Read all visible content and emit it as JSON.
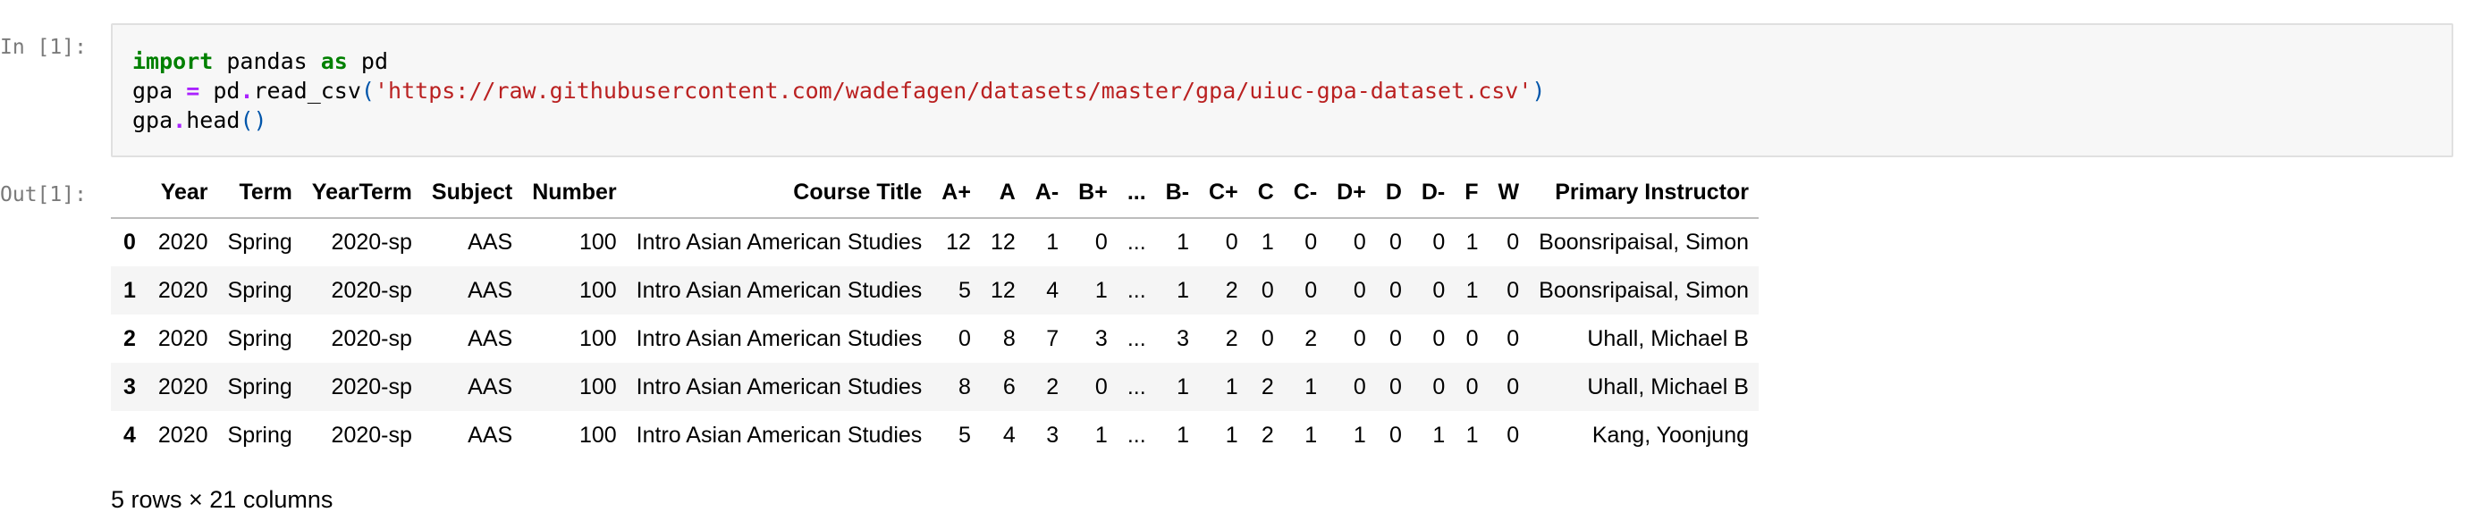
{
  "input_cell": {
    "prompt": "In [1]:",
    "code": {
      "line1": {
        "kw_import": "import",
        "module": " pandas ",
        "kw_as": "as",
        "alias": " pd"
      },
      "line2": {
        "var": "gpa ",
        "eq": "=",
        "call": " pd",
        "dot": ".",
        "func": "read_csv",
        "open": "(",
        "url": "'https://raw.githubusercontent.com/wadefagen/datasets/master/gpa/uiuc-gpa-dataset.csv'",
        "close": ")"
      },
      "line3": {
        "var": "gpa",
        "dot": ".",
        "func": "head",
        "parens": "()"
      }
    }
  },
  "output_cell": {
    "prompt": "Out[1]:",
    "table": {
      "columns": [
        "",
        "Year",
        "Term",
        "YearTerm",
        "Subject",
        "Number",
        "Course Title",
        "A+",
        "A",
        "A-",
        "B+",
        "...",
        "B-",
        "C+",
        "C",
        "C-",
        "D+",
        "D",
        "D-",
        "F",
        "W",
        "Primary Instructor"
      ],
      "rows": [
        [
          "0",
          "2020",
          "Spring",
          "2020-sp",
          "AAS",
          "100",
          "Intro Asian American Studies",
          "12",
          "12",
          "1",
          "0",
          "...",
          "1",
          "0",
          "1",
          "0",
          "0",
          "0",
          "0",
          "1",
          "0",
          "Boonsripaisal, Simon"
        ],
        [
          "1",
          "2020",
          "Spring",
          "2020-sp",
          "AAS",
          "100",
          "Intro Asian American Studies",
          "5",
          "12",
          "4",
          "1",
          "...",
          "1",
          "2",
          "0",
          "0",
          "0",
          "0",
          "0",
          "1",
          "0",
          "Boonsripaisal, Simon"
        ],
        [
          "2",
          "2020",
          "Spring",
          "2020-sp",
          "AAS",
          "100",
          "Intro Asian American Studies",
          "0",
          "8",
          "7",
          "3",
          "...",
          "3",
          "2",
          "0",
          "2",
          "0",
          "0",
          "0",
          "0",
          "0",
          "Uhall, Michael B"
        ],
        [
          "3",
          "2020",
          "Spring",
          "2020-sp",
          "AAS",
          "100",
          "Intro Asian American Studies",
          "8",
          "6",
          "2",
          "0",
          "...",
          "1",
          "1",
          "2",
          "1",
          "0",
          "0",
          "0",
          "0",
          "0",
          "Uhall, Michael B"
        ],
        [
          "4",
          "2020",
          "Spring",
          "2020-sp",
          "AAS",
          "100",
          "Intro Asian American Studies",
          "5",
          "4",
          "3",
          "1",
          "...",
          "1",
          "1",
          "2",
          "1",
          "1",
          "0",
          "1",
          "1",
          "0",
          "Kang, Yoonjung"
        ]
      ]
    },
    "shape_note": "5 rows × 21 columns"
  },
  "colors": {
    "keyword": "#008000",
    "operator": "#aa22ff",
    "string": "#ba2121",
    "prompt": "#7a7a7a",
    "cell_background": "#f7f7f7",
    "striped_row": "#f5f5f5"
  }
}
